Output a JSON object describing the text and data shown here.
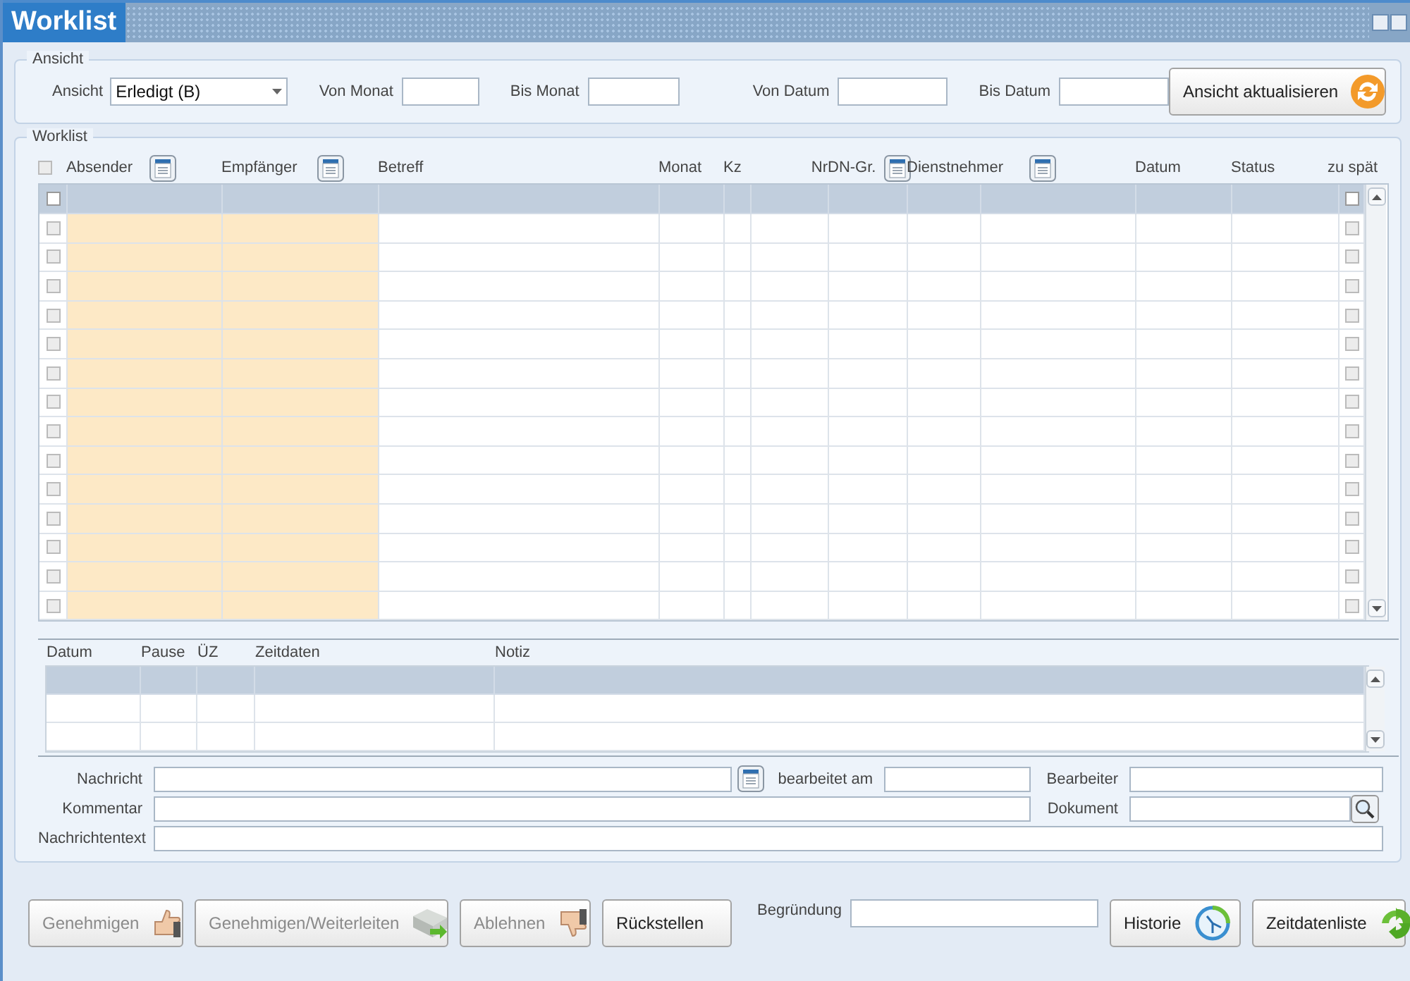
{
  "window": {
    "title": "Worklist"
  },
  "ansicht": {
    "legend": "Ansicht",
    "view_label": "Ansicht",
    "view_value": "Erledigt (B)",
    "fields": [
      {
        "label": "Von Monat"
      },
      {
        "label": "Bis Monat"
      },
      {
        "label": "Von Datum"
      },
      {
        "label": "Bis Datum"
      }
    ],
    "refresh_button": "Ansicht aktualisieren"
  },
  "worklist": {
    "legend": "Worklist",
    "select_all_checked": false,
    "columns": [
      {
        "label": "Absender",
        "filter": true
      },
      {
        "label": "Empfänger",
        "filter": true
      },
      {
        "label": "Betreff",
        "filter": false
      },
      {
        "label": "Monat",
        "filter": false
      },
      {
        "label": "Kz",
        "filter": false
      },
      {
        "label": "Nr",
        "filter": false
      },
      {
        "label": "DN-Gr.",
        "filter": true
      },
      {
        "label": "Dienstnehmer",
        "filter": true
      },
      {
        "label": "Datum",
        "filter": false
      },
      {
        "label": "Status",
        "filter": false
      },
      {
        "label": "zu spät",
        "filter": false
      }
    ],
    "header_row": {
      "checked": false,
      "late": false
    },
    "rows": [
      {
        "checked": false,
        "late": false
      },
      {
        "checked": false,
        "late": false
      },
      {
        "checked": false,
        "late": false
      },
      {
        "checked": false,
        "late": false
      },
      {
        "checked": false,
        "late": false
      },
      {
        "checked": false,
        "late": false
      },
      {
        "checked": false,
        "late": false
      },
      {
        "checked": false,
        "late": false
      },
      {
        "checked": false,
        "late": false
      },
      {
        "checked": false,
        "late": false
      },
      {
        "checked": false,
        "late": false
      },
      {
        "checked": false,
        "late": false
      },
      {
        "checked": false,
        "late": false
      },
      {
        "checked": false,
        "late": false
      }
    ]
  },
  "details": {
    "columns": [
      "Datum",
      "Pause",
      "ÜZ",
      "Zeitdaten",
      "Notiz"
    ]
  },
  "form": {
    "nachricht": "Nachricht",
    "bearbeitet_am": "bearbeitet am",
    "bearbeiter": "Bearbeiter",
    "kommentar": "Kommentar",
    "dokument": "Dokument",
    "nachrichtentext": "Nachrichtentext"
  },
  "buttons": [
    {
      "label": "Genehmigen",
      "kind": "approve",
      "disabled": true
    },
    {
      "label": "Genehmigen/Weiterleiten",
      "kind": "forward",
      "disabled": true
    },
    {
      "label": "Ablehnen",
      "kind": "reject",
      "disabled": true
    },
    {
      "label": "Rückstellen",
      "kind": "plain",
      "disabled": false
    }
  ],
  "begruendung": {
    "label": "Begründung"
  },
  "right_buttons": [
    {
      "label": "Historie",
      "kind": "history",
      "disabled": false
    },
    {
      "label": "Zeitdatenliste",
      "kind": "recycle",
      "disabled": false
    }
  ]
}
